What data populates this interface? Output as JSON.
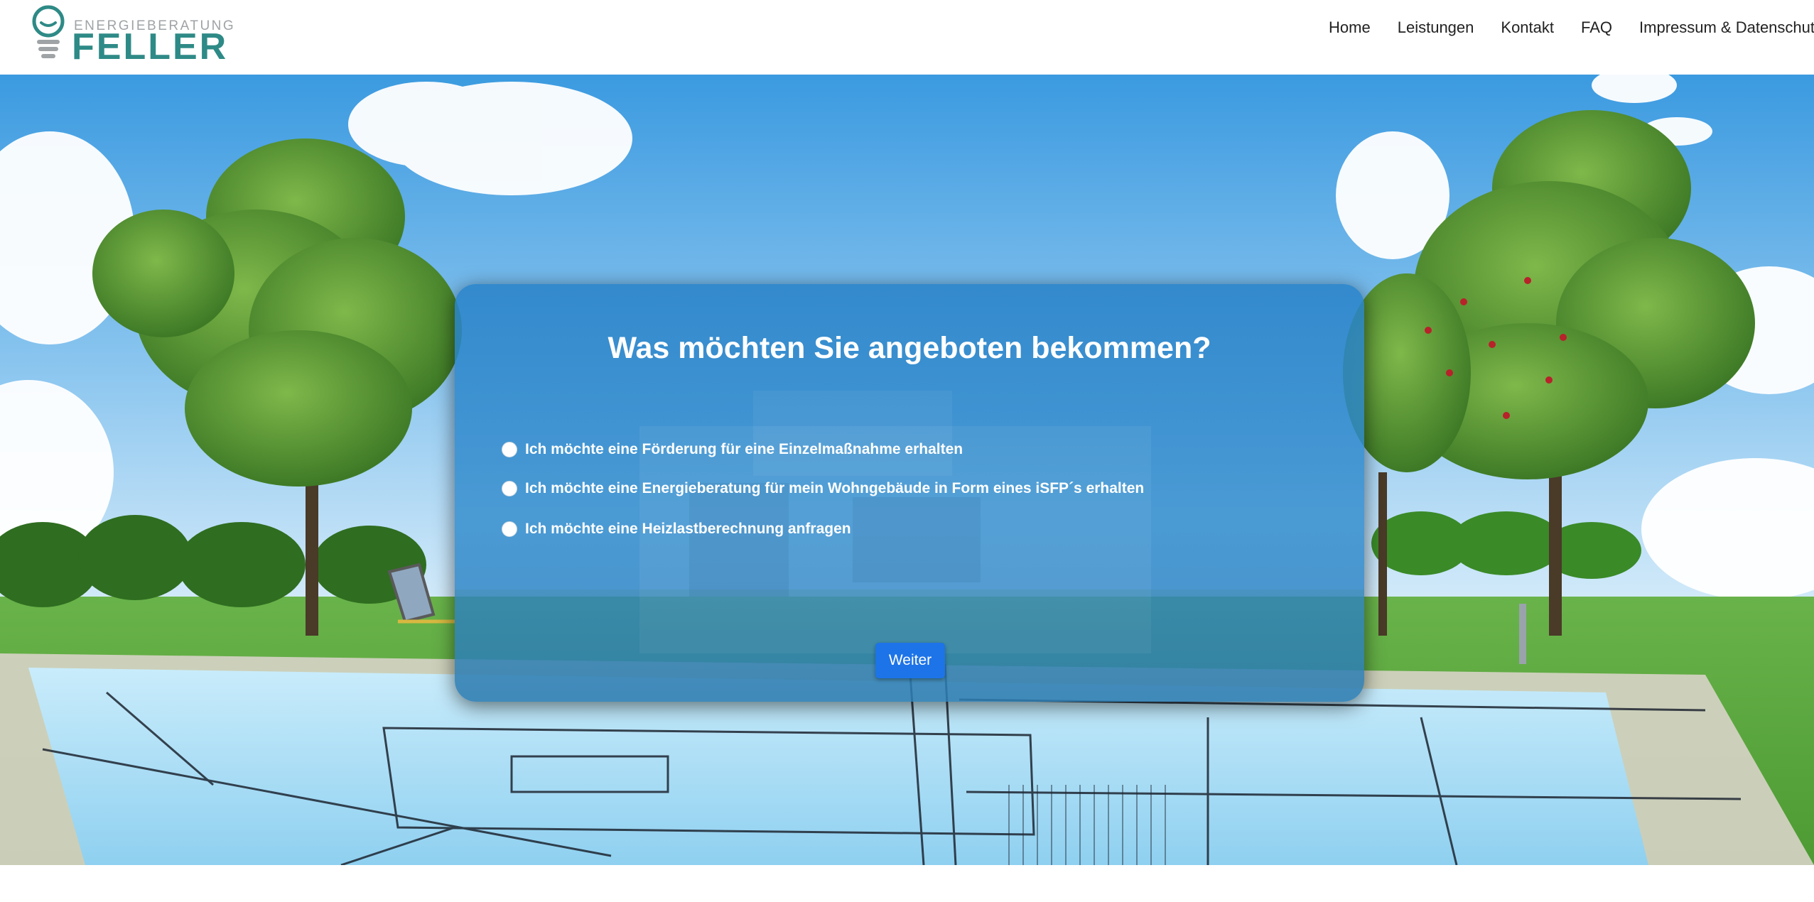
{
  "brand": {
    "top_text": "ENERGIEBERATUNG",
    "name": "FELLER",
    "color": "#2e8a86"
  },
  "nav": {
    "items": [
      {
        "label": "Home"
      },
      {
        "label": "Leistungen"
      },
      {
        "label": "Kontakt"
      },
      {
        "label": "FAQ"
      },
      {
        "label": "Impressum & Datenschutz"
      }
    ]
  },
  "form": {
    "title": "Was möchten Sie angeboten bekommen?",
    "options": [
      {
        "label": "Ich möchte eine Förderung für eine Einzelmaßnahme erhalten",
        "selected": false
      },
      {
        "label": "Ich möchte eine Energieberatung für mein Wohngebäude in Form eines iSFP´s erhalten",
        "selected": false
      },
      {
        "label": "Ich möchte eine Heizlastberechnung anfragen",
        "selected": false
      }
    ],
    "submit_label": "Weiter",
    "accent": "#1d74e8"
  }
}
